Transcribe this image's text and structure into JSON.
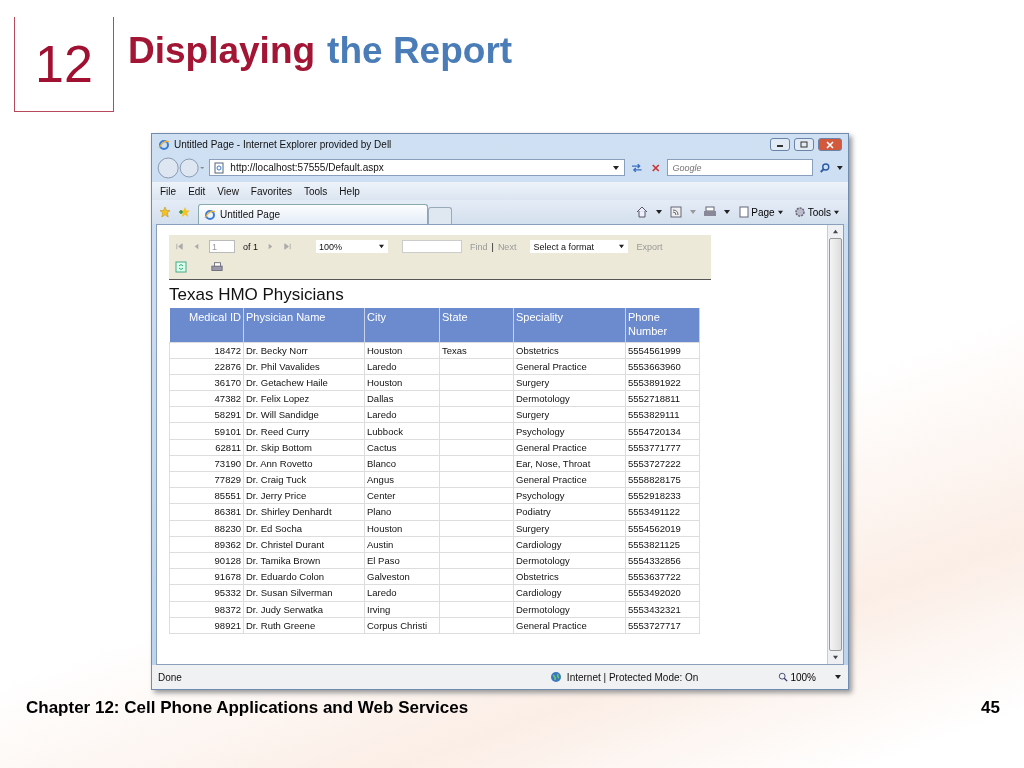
{
  "slide": {
    "number": "12",
    "title": [
      {
        "text": "Displaying",
        "kind": "accent"
      },
      {
        "text": "the Report",
        "kind": "plain"
      }
    ],
    "footer": "Chapter 12: Cell Phone Applications and Web Services",
    "page": "45"
  },
  "browser": {
    "title": "Untitled Page - Internet Explorer provided by Dell",
    "address": "http://localhost:57555/Default.aspx",
    "search_placeholder": "Google",
    "menu": [
      "File",
      "Edit",
      "View",
      "Favorites",
      "Tools",
      "Help"
    ],
    "tab": "Untitled Page",
    "commands": [
      "Page",
      "Tools"
    ],
    "status": "Done",
    "zone": "Internet | Protected Mode: On",
    "zoom": "100%"
  },
  "report_toolbar": {
    "page": "1",
    "page_count": "of 1",
    "zoom": "100%",
    "find": {
      "label": "Find",
      "disabled": true
    },
    "separator": "|",
    "next": {
      "label": "Next",
      "disabled": true
    },
    "format": "Select a format",
    "export": {
      "label": "Export",
      "disabled": true
    }
  },
  "report": {
    "title": "Texas HMO Physicians",
    "columns": [
      "Medical ID",
      "Physician Name",
      "City",
      "State",
      "Speciality",
      "Phone Number"
    ],
    "rows": [
      [
        "18472",
        "Dr. Becky Norr",
        "Houston",
        "Texas",
        "Obstetrics",
        "5554561999"
      ],
      [
        "22876",
        "Dr. Phil Vavalides",
        "Laredo",
        "",
        "General Practice",
        "5553663960"
      ],
      [
        "36170",
        "Dr. Getachew Haile",
        "Houston",
        "",
        "Surgery",
        "5553891922"
      ],
      [
        "47382",
        "Dr. Felix Lopez",
        "Dallas",
        "",
        "Dermotology",
        "5552718811"
      ],
      [
        "58291",
        "Dr. Will Sandidge",
        "Laredo",
        "",
        "Surgery",
        "5553829111"
      ],
      [
        "59101",
        "Dr. Reed Curry",
        "Lubbock",
        "",
        "Psychology",
        "5554720134"
      ],
      [
        "62811",
        "Dr. Skip Bottom",
        "Cactus",
        "",
        "General Practice",
        "5553771777"
      ],
      [
        "73190",
        "Dr. Ann Rovetto",
        "Blanco",
        "",
        "Ear, Nose, Throat",
        "5553727222"
      ],
      [
        "77829",
        "Dr. Craig Tuck",
        "Angus",
        "",
        "General Practice",
        "5558828175"
      ],
      [
        "85551",
        "Dr. Jerry Price",
        "Center",
        "",
        "Psychology",
        "5552918233"
      ],
      [
        "86381",
        "Dr. Shirley Denhardt",
        "Plano",
        "",
        "Podiatry",
        "5553491122"
      ],
      [
        "88230",
        "Dr. Ed Socha",
        "Houston",
        "",
        "Surgery",
        "5554562019"
      ],
      [
        "89362",
        "Dr. Christel Durant",
        "Austin",
        "",
        "Cardiology",
        "5553821125"
      ],
      [
        "90128",
        "Dr. Tamika Brown",
        "El Paso",
        "",
        "Dermotology",
        "5554332856"
      ],
      [
        "91678",
        "Dr. Eduardo Colon",
        "Galveston",
        "",
        "Obstetrics",
        "5553637722"
      ],
      [
        "95332",
        "Dr. Susan Silverman",
        "Laredo",
        "",
        "Cardiology",
        "5553492020"
      ],
      [
        "98372",
        "Dr. Judy Serwatka",
        "Irving",
        "",
        "Dermotology",
        "5553432321"
      ],
      [
        "98921",
        "Dr. Ruth Greene",
        "Corpus Christi",
        "",
        "General Practice",
        "5553727717"
      ]
    ]
  }
}
